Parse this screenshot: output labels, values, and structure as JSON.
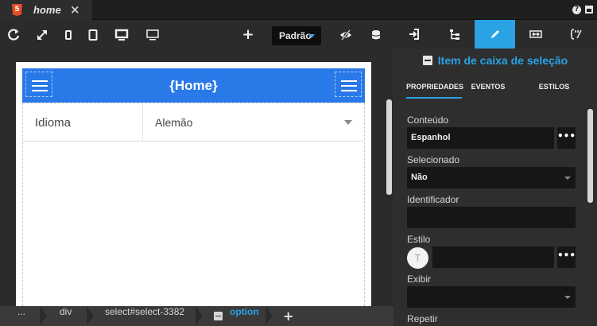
{
  "tab": {
    "badge": "5",
    "title": "home",
    "close": "×"
  },
  "window": {
    "help": "?"
  },
  "toolbar": {
    "add": "+",
    "profile": "Padrão"
  },
  "app": {
    "title": "{Home}"
  },
  "select_row": {
    "label": "Idioma",
    "value": "Alemão"
  },
  "breadcrumbs": {
    "root": "...",
    "div": "div",
    "select": "select#select-3382",
    "option": "option",
    "add": "+"
  },
  "panel": {
    "title": "Item de caixa de seleção",
    "subtabs": [
      "PROPRIEDADES",
      "EVENTOS",
      "ESTILOS"
    ],
    "fields": {
      "conteudo_label": "Conteúdo",
      "conteudo_value": "Espanhol",
      "selecionado_label": "Selecionado",
      "selecionado_value": "Não",
      "identificador_label": "Identificador",
      "identificador_value": "",
      "estilo_label": "Estilo",
      "estilo_circle": "T",
      "exibir_label": "Exibir",
      "repetir_label": "Repetir"
    },
    "more_button": "•••"
  },
  "colors": {
    "accent": "#2aa2e3",
    "appbar": "#2979e8",
    "html5": "#e44d26"
  }
}
